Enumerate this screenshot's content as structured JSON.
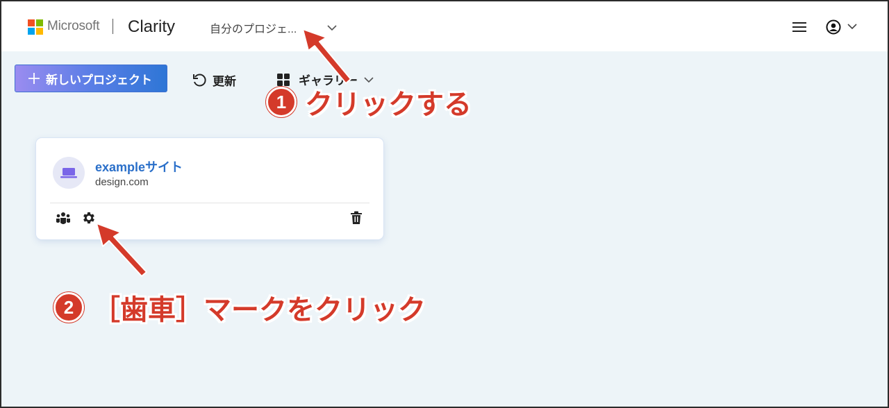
{
  "header": {
    "brand": "Microsoft",
    "app_name": "Clarity",
    "project_selector": "自分のプロジェ...",
    "menu_icon": "hamburger-icon",
    "user_icon": "user-circle-icon"
  },
  "toolbar": {
    "new_project_label": "新しいプロジェクト",
    "refresh_label": "更新",
    "view_label": "ギャラリー"
  },
  "project_card": {
    "name": "exampleサイト",
    "domain": "design.com",
    "icons": [
      "team-icon",
      "gear-icon",
      "trash-icon"
    ]
  },
  "annotations": [
    {
      "number": "1",
      "text": "クリックする"
    },
    {
      "number": "2",
      "text": "［歯車］マークをクリック"
    }
  ],
  "colors": {
    "accent": "#2a6fc9",
    "annotation": "#d43a2a",
    "page_bg": "#edf4f8"
  }
}
